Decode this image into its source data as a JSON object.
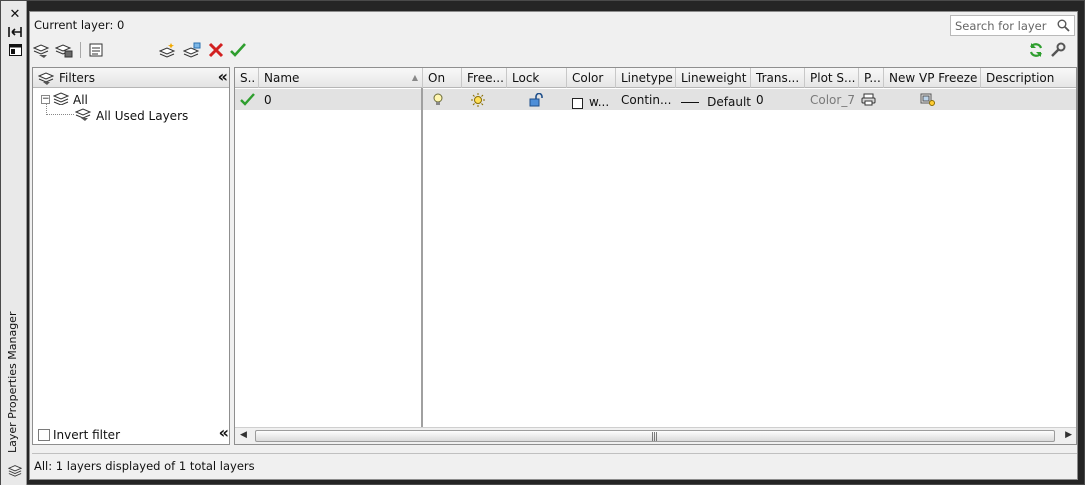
{
  "palette": {
    "title": "Layer Properties Manager",
    "close_icon": "close-icon",
    "autohide_icon": "autohide-icon",
    "properties_icon": "properties-icon"
  },
  "header": {
    "current_layer": "Current layer: 0",
    "search_placeholder": "Search for layer"
  },
  "filters": {
    "title": "Filters",
    "tree": [
      {
        "label": "All",
        "level": 0
      },
      {
        "label": "All Used Layers",
        "level": 1
      }
    ],
    "invert_filter_label": "Invert filter"
  },
  "columns": [
    "S..",
    "Name",
    "On",
    "Free...",
    "Lock",
    "Color",
    "Linetype",
    "Lineweight",
    "Trans...",
    "Plot S...",
    "P...",
    "New VP Freeze",
    "Description"
  ],
  "layers": [
    {
      "status": "current",
      "name": "0",
      "on": "on",
      "freeze": "thawed",
      "lock": "unlocked",
      "color_swatch": "#ffffff",
      "color": "w...",
      "linetype": "Contin...",
      "lineweight": "Default",
      "transparency": "0",
      "plot_style": "Color_7",
      "plot": "plottable",
      "new_vp_freeze": "thawed",
      "description": ""
    }
  ],
  "status_bar": "All: 1 layers displayed of 1 total layers",
  "colors": {
    "accent_green": "#2e9e2e",
    "delete_red": "#d22020",
    "row_selected": "#e2e2e2"
  }
}
